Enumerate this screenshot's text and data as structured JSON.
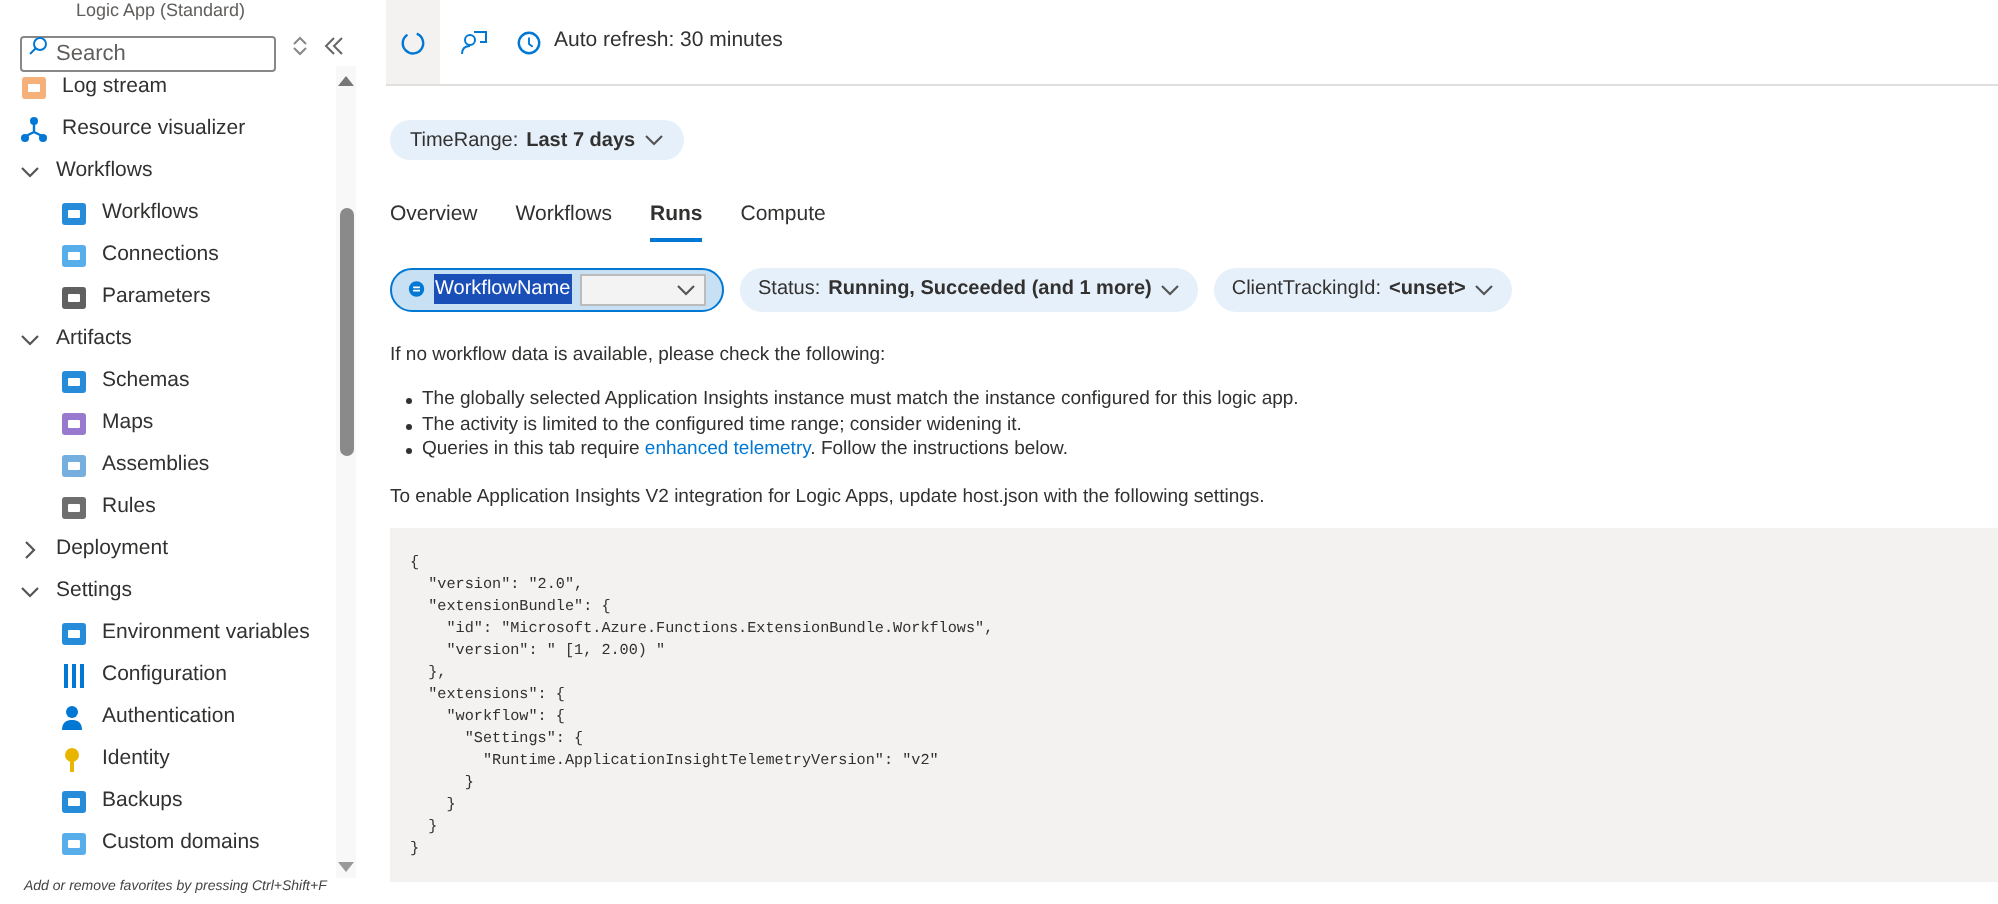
{
  "sidebar": {
    "subtitle": "Logic App (Standard)",
    "search": {
      "placeholder": "Search"
    },
    "items": [
      {
        "label": "Log stream",
        "kind": "log"
      },
      {
        "label": "Resource visualizer",
        "kind": "visualizer"
      },
      {
        "label": "Workflows",
        "kind": "group",
        "expanded": true,
        "children": [
          {
            "label": "Workflows",
            "kind": "workflows"
          },
          {
            "label": "Connections",
            "kind": "connections"
          },
          {
            "label": "Parameters",
            "kind": "parameters"
          }
        ]
      },
      {
        "label": "Artifacts",
        "kind": "group",
        "expanded": true,
        "children": [
          {
            "label": "Schemas",
            "kind": "schemas"
          },
          {
            "label": "Maps",
            "kind": "maps"
          },
          {
            "label": "Assemblies",
            "kind": "assemblies"
          },
          {
            "label": "Rules",
            "kind": "rules"
          }
        ]
      },
      {
        "label": "Deployment",
        "kind": "group",
        "expanded": false
      },
      {
        "label": "Settings",
        "kind": "group",
        "expanded": true,
        "children": [
          {
            "label": "Environment variables",
            "kind": "env"
          },
          {
            "label": "Configuration",
            "kind": "config"
          },
          {
            "label": "Authentication",
            "kind": "auth"
          },
          {
            "label": "Identity",
            "kind": "identity"
          },
          {
            "label": "Backups",
            "kind": "backups"
          },
          {
            "label": "Custom domains",
            "kind": "domains"
          }
        ]
      }
    ],
    "hint": "Add or remove favorites by pressing Ctrl+Shift+F"
  },
  "toolbar": {
    "auto_refresh": "Auto refresh: 30 minutes"
  },
  "time_range": {
    "label": "TimeRange:",
    "value": "Last 7 days"
  },
  "tabs": [
    {
      "label": "Overview",
      "selected": false
    },
    {
      "label": "Workflows",
      "selected": false
    },
    {
      "label": "Runs",
      "selected": true
    },
    {
      "label": "Compute",
      "selected": false
    }
  ],
  "filters": [
    {
      "kind": "input",
      "label": "WorkflowName",
      "selected": true
    },
    {
      "kind": "pill",
      "label": "Status:",
      "value": "Running, Succeeded (and 1 more)",
      "selected": false
    },
    {
      "kind": "pill",
      "label": "ClientTrackingId:",
      "value": "<unset>",
      "selected": false
    }
  ],
  "intro": "If no workflow data is available, please check the following:",
  "bullets": [
    {
      "text": "The globally selected Application Insights instance must match the instance configured for this logic app."
    },
    {
      "text": "The activity is limited to the configured time range; consider widening it."
    },
    {
      "text": "Queries in this tab require",
      "link": "enhanced telemetry",
      "after": ". Follow the instructions below."
    }
  ],
  "instructions": "To enable Application Insights V2 integration for Logic Apps, update host.json with the following settings.",
  "code": [
    "{",
    "  \"version\": \"2.0\",",
    "  \"extensionBundle\": {",
    "    \"id\": \"Microsoft.Azure.Functions.ExtensionBundle.Workflows\",",
    "    \"version\": \" [1, 2.00) \"",
    "  },",
    "  \"extensions\": {",
    "    \"workflow\": {",
    "      \"Settings\": {",
    "        \"Runtime.ApplicationInsightTelemetryVersion\": \"v2\"",
    "      }",
    "    }",
    "  }",
    "}"
  ]
}
